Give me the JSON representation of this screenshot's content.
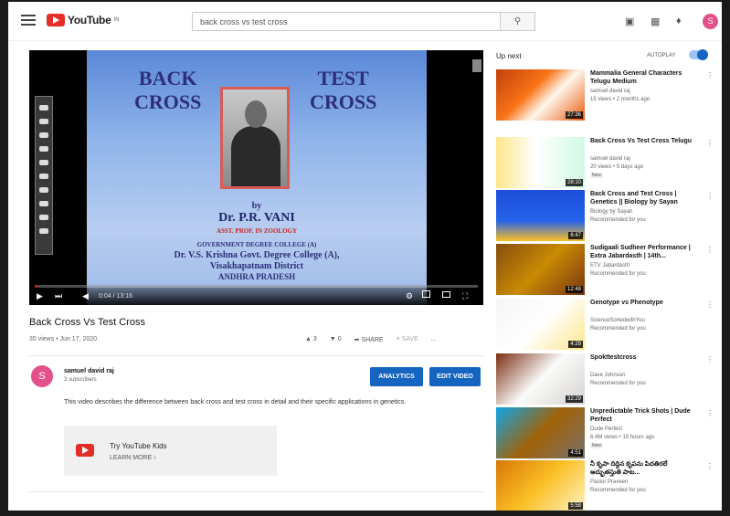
{
  "header": {
    "logo_text": "YouTube",
    "logo_sup": "IN",
    "search_value": "back cross vs test cross"
  },
  "player": {
    "slide": {
      "title_left_1": "BACK",
      "title_left_2": "CROSS",
      "title_right_1": "TEST",
      "title_right_2": "CROSS",
      "by": "by",
      "author": "Dr. P.R. VANI",
      "designation": "ASST. PROF. IN ZOOLOGY",
      "inst_1": "GOVERNMENT DEGREE COLLEGE (A)",
      "inst_2": "Dr. V.S. Krishna Govt. Degree College (A),",
      "inst_3": "Visakhapatnam District",
      "inst_4": "ANDHRA PRADESH"
    },
    "time": "0:04 / 13:16",
    "progress": 0.005
  },
  "video": {
    "title": "Back Cross Vs Test Cross",
    "meta": "35 views • Jun 17, 2020",
    "likes": "3",
    "dislikes": "0",
    "share": "SHARE",
    "save": "SAVE",
    "more": "..."
  },
  "channel": {
    "avatar_letter": "S",
    "name": "samuel david raj",
    "subs": "3 subscribers",
    "analytics": "ANALYTICS",
    "edit": "EDIT VIDEO",
    "description": "This video describes the difference between back cross and test cross in detail and their specific applications in genetics."
  },
  "kids": {
    "title": "Try YouTube Kids",
    "link": "LEARN MORE ›"
  },
  "sidebar": {
    "up_next": "Up next",
    "autoplay": "AUTOPLAY",
    "items": [
      {
        "title": "Mammalia General Characters Telugu Medium",
        "channel": "samuel david raj",
        "stats": "15 views • 2 months ago",
        "duration": "27:36",
        "badge": ""
      },
      {
        "title": "Back Cross Vs Test Cross Telugu",
        "channel": "samuel david raj",
        "stats": "20 views • 5 days ago",
        "duration": "28:10",
        "badge": "New"
      },
      {
        "title": "Back Cross and Test Cross | Genetics || Biology by Sayan",
        "channel": "Biology by Sayan",
        "stats": "Recommended for you",
        "duration": "6:47",
        "badge": ""
      },
      {
        "title": "Sudigaali Sudheer Performance | Extra Jabardasth | 14th...",
        "channel": "ETV Jabardasth",
        "stats": "Recommended for you",
        "duration": "12:48",
        "badge": ""
      },
      {
        "title": "Genotype vs Phenotype",
        "channel": "ScienceSortedwithYou",
        "stats": "Recommended for you",
        "duration": "4:29",
        "badge": ""
      },
      {
        "title": "Spokttestcross",
        "channel": "Dave Johnson",
        "stats": "Recommended for you",
        "duration": "32:29",
        "badge": ""
      },
      {
        "title": "Unpredictable Trick Shots | Dude Perfect",
        "channel": "Dude Perfect",
        "stats": "6.4M views • 15 hours ago",
        "duration": "4:51",
        "badge": "New"
      },
      {
        "title": "నీ కృపా దిద్దిన కృపను పిదతిరలే అద్భుతస్తుతి పాట...",
        "channel": "Pastor Praveen",
        "stats": "Recommended for you",
        "duration": "5:58",
        "badge": ""
      }
    ]
  },
  "colors": {
    "brand_red": "#e52d27",
    "button_blue": "#1565c0",
    "avatar_pink": "#e3508a"
  }
}
